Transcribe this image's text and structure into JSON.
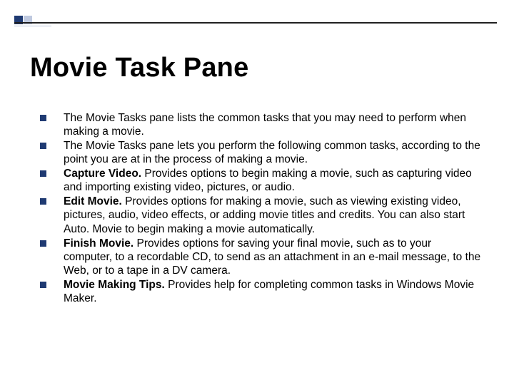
{
  "title": "Movie Task Pane",
  "bullets": [
    {
      "bold": "",
      "body": "The Movie Tasks pane lists the common tasks that you may need to perform when making a movie."
    },
    {
      "bold": "",
      "body": "The Movie Tasks pane lets you perform the following common tasks, according to the point you are at in the process of making a movie."
    },
    {
      "bold": "Capture Video.",
      "body": " Provides options to begin making a movie, such as capturing video and importing existing video, pictures, or audio."
    },
    {
      "bold": "Edit Movie.",
      "body": " Provides options for making a movie, such as viewing existing video, pictures, audio, video effects, or adding movie titles and credits. You can also start Auto. Movie to begin making a movie automatically."
    },
    {
      "bold": "Finish Movie.",
      "body": " Provides options for saving your final movie, such as to your computer, to a recordable CD, to send as an attachment in an e-mail message, to the Web, or to a tape in a DV camera."
    },
    {
      "bold": "Movie Making Tips.",
      "body": " Provides help for completing common tasks in Windows Movie Maker."
    }
  ]
}
